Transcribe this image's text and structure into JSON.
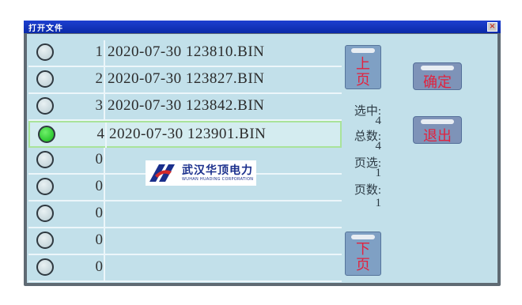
{
  "window": {
    "title": "打开文件",
    "close": "×"
  },
  "files": [
    {
      "index": "1",
      "name": "2020-07-30  123810.BIN",
      "selected": false
    },
    {
      "index": "2",
      "name": "2020-07-30  123827.BIN",
      "selected": false
    },
    {
      "index": "3",
      "name": "2020-07-30  123842.BIN",
      "selected": false
    },
    {
      "index": "4",
      "name": "2020-07-30  123901.BIN",
      "selected": true
    },
    {
      "index": "0",
      "name": "",
      "selected": false
    },
    {
      "index": "0",
      "name": "",
      "selected": false
    },
    {
      "index": "0",
      "name": "",
      "selected": false
    },
    {
      "index": "0",
      "name": "",
      "selected": false
    },
    {
      "index": "0",
      "name": "",
      "selected": false
    }
  ],
  "paging": {
    "prev_top": "上",
    "prev_bottom": "页",
    "next_top": "下",
    "next_bottom": "页"
  },
  "info": {
    "selected_label": "选中:",
    "selected_value": "4",
    "total_label": "总数:",
    "total_value": "4",
    "page_label": "页选:",
    "page_value": "1",
    "pages_label": "页数:",
    "pages_value": "1"
  },
  "actions": {
    "confirm": "确定",
    "exit": "退出"
  },
  "watermark": {
    "company_cn": "武汉华顶电力",
    "company_en": "WUHAN HUADING CORPORATION"
  },
  "colors": {
    "screen": "#c2e0ea",
    "titlebar": "#0a2aa8",
    "button_text": "#e2223e",
    "radio_on": "#12b81a"
  }
}
